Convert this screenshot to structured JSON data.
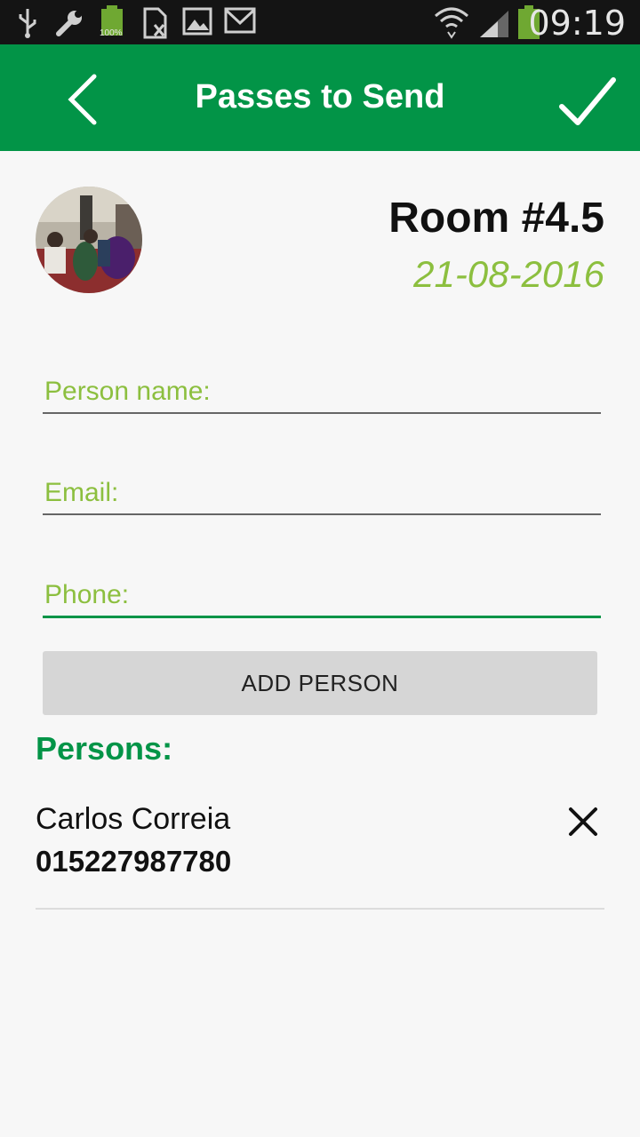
{
  "status_bar": {
    "time": "09:19",
    "battery_small_label": "100%",
    "icons": [
      "usb-icon",
      "wrench-icon",
      "battery-100-icon",
      "sim-blocked-icon",
      "image-icon",
      "gmail-icon",
      "wifi-icon",
      "signal-icon",
      "battery-icon"
    ]
  },
  "app_bar": {
    "title": "Passes to Send",
    "back_icon": "chevron-left-icon",
    "confirm_icon": "check-icon"
  },
  "room": {
    "name": "Room #4.5",
    "date": "21-08-2016"
  },
  "form": {
    "name_placeholder": "Person name:",
    "email_placeholder": "Email:",
    "phone_placeholder": "Phone:",
    "add_button": "ADD PERSON"
  },
  "persons": {
    "label": "Persons:",
    "items": [
      {
        "name": "Carlos Correia",
        "phone": "015227987780"
      }
    ]
  },
  "colors": {
    "primary": "#029447",
    "accent": "#8cbf3f",
    "status_bar": "#141414",
    "background": "#f7f7f7"
  }
}
